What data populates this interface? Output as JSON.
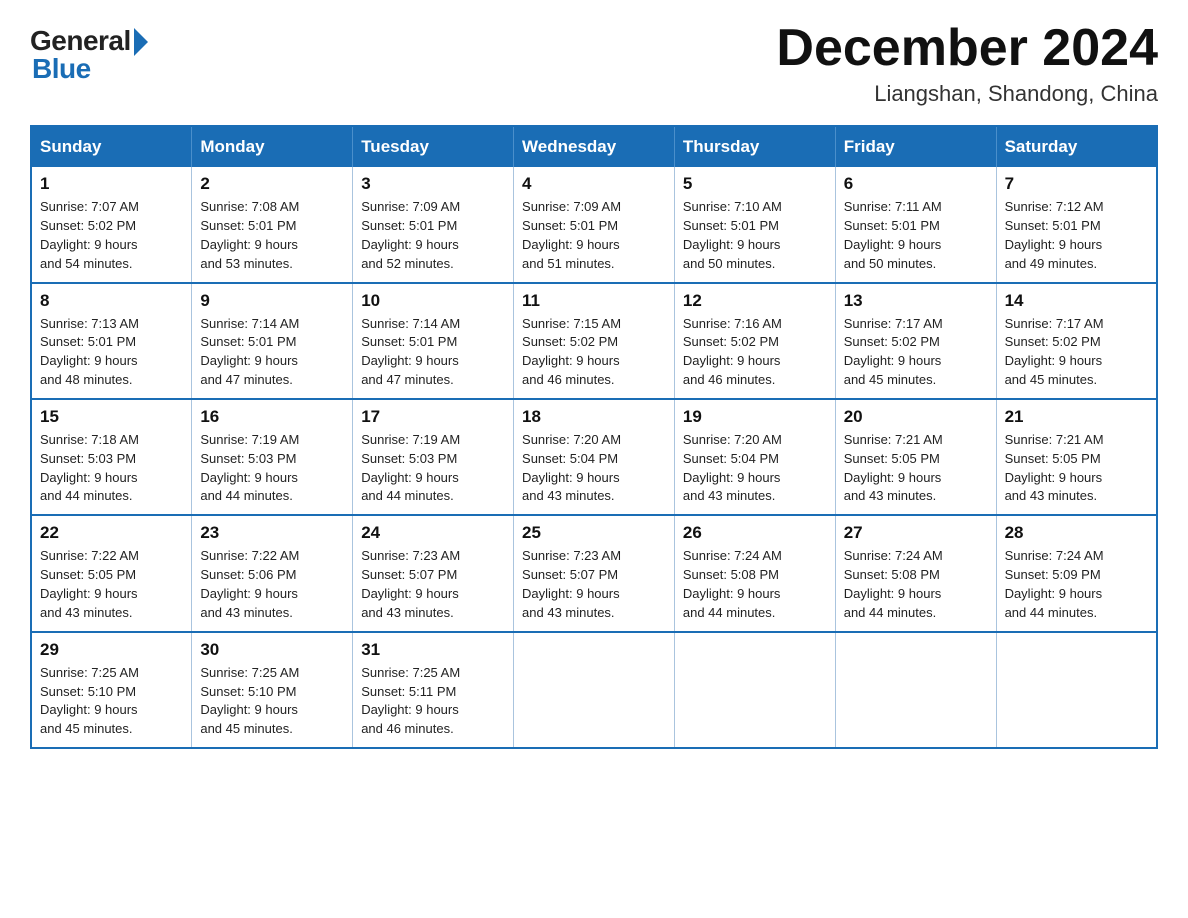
{
  "logo": {
    "general": "General",
    "blue": "Blue"
  },
  "header": {
    "month_title": "December 2024",
    "location": "Liangshan, Shandong, China"
  },
  "days_of_week": [
    "Sunday",
    "Monday",
    "Tuesday",
    "Wednesday",
    "Thursday",
    "Friday",
    "Saturday"
  ],
  "weeks": [
    [
      {
        "day": "1",
        "sunrise": "7:07 AM",
        "sunset": "5:02 PM",
        "daylight": "9 hours and 54 minutes."
      },
      {
        "day": "2",
        "sunrise": "7:08 AM",
        "sunset": "5:01 PM",
        "daylight": "9 hours and 53 minutes."
      },
      {
        "day": "3",
        "sunrise": "7:09 AM",
        "sunset": "5:01 PM",
        "daylight": "9 hours and 52 minutes."
      },
      {
        "day": "4",
        "sunrise": "7:09 AM",
        "sunset": "5:01 PM",
        "daylight": "9 hours and 51 minutes."
      },
      {
        "day": "5",
        "sunrise": "7:10 AM",
        "sunset": "5:01 PM",
        "daylight": "9 hours and 50 minutes."
      },
      {
        "day": "6",
        "sunrise": "7:11 AM",
        "sunset": "5:01 PM",
        "daylight": "9 hours and 50 minutes."
      },
      {
        "day": "7",
        "sunrise": "7:12 AM",
        "sunset": "5:01 PM",
        "daylight": "9 hours and 49 minutes."
      }
    ],
    [
      {
        "day": "8",
        "sunrise": "7:13 AM",
        "sunset": "5:01 PM",
        "daylight": "9 hours and 48 minutes."
      },
      {
        "day": "9",
        "sunrise": "7:14 AM",
        "sunset": "5:01 PM",
        "daylight": "9 hours and 47 minutes."
      },
      {
        "day": "10",
        "sunrise": "7:14 AM",
        "sunset": "5:01 PM",
        "daylight": "9 hours and 47 minutes."
      },
      {
        "day": "11",
        "sunrise": "7:15 AM",
        "sunset": "5:02 PM",
        "daylight": "9 hours and 46 minutes."
      },
      {
        "day": "12",
        "sunrise": "7:16 AM",
        "sunset": "5:02 PM",
        "daylight": "9 hours and 46 minutes."
      },
      {
        "day": "13",
        "sunrise": "7:17 AM",
        "sunset": "5:02 PM",
        "daylight": "9 hours and 45 minutes."
      },
      {
        "day": "14",
        "sunrise": "7:17 AM",
        "sunset": "5:02 PM",
        "daylight": "9 hours and 45 minutes."
      }
    ],
    [
      {
        "day": "15",
        "sunrise": "7:18 AM",
        "sunset": "5:03 PM",
        "daylight": "9 hours and 44 minutes."
      },
      {
        "day": "16",
        "sunrise": "7:19 AM",
        "sunset": "5:03 PM",
        "daylight": "9 hours and 44 minutes."
      },
      {
        "day": "17",
        "sunrise": "7:19 AM",
        "sunset": "5:03 PM",
        "daylight": "9 hours and 44 minutes."
      },
      {
        "day": "18",
        "sunrise": "7:20 AM",
        "sunset": "5:04 PM",
        "daylight": "9 hours and 43 minutes."
      },
      {
        "day": "19",
        "sunrise": "7:20 AM",
        "sunset": "5:04 PM",
        "daylight": "9 hours and 43 minutes."
      },
      {
        "day": "20",
        "sunrise": "7:21 AM",
        "sunset": "5:05 PM",
        "daylight": "9 hours and 43 minutes."
      },
      {
        "day": "21",
        "sunrise": "7:21 AM",
        "sunset": "5:05 PM",
        "daylight": "9 hours and 43 minutes."
      }
    ],
    [
      {
        "day": "22",
        "sunrise": "7:22 AM",
        "sunset": "5:05 PM",
        "daylight": "9 hours and 43 minutes."
      },
      {
        "day": "23",
        "sunrise": "7:22 AM",
        "sunset": "5:06 PM",
        "daylight": "9 hours and 43 minutes."
      },
      {
        "day": "24",
        "sunrise": "7:23 AM",
        "sunset": "5:07 PM",
        "daylight": "9 hours and 43 minutes."
      },
      {
        "day": "25",
        "sunrise": "7:23 AM",
        "sunset": "5:07 PM",
        "daylight": "9 hours and 43 minutes."
      },
      {
        "day": "26",
        "sunrise": "7:24 AM",
        "sunset": "5:08 PM",
        "daylight": "9 hours and 44 minutes."
      },
      {
        "day": "27",
        "sunrise": "7:24 AM",
        "sunset": "5:08 PM",
        "daylight": "9 hours and 44 minutes."
      },
      {
        "day": "28",
        "sunrise": "7:24 AM",
        "sunset": "5:09 PM",
        "daylight": "9 hours and 44 minutes."
      }
    ],
    [
      {
        "day": "29",
        "sunrise": "7:25 AM",
        "sunset": "5:10 PM",
        "daylight": "9 hours and 45 minutes."
      },
      {
        "day": "30",
        "sunrise": "7:25 AM",
        "sunset": "5:10 PM",
        "daylight": "9 hours and 45 minutes."
      },
      {
        "day": "31",
        "sunrise": "7:25 AM",
        "sunset": "5:11 PM",
        "daylight": "9 hours and 46 minutes."
      },
      null,
      null,
      null,
      null
    ]
  ],
  "labels": {
    "sunrise": "Sunrise:",
    "sunset": "Sunset:",
    "daylight": "Daylight:"
  }
}
